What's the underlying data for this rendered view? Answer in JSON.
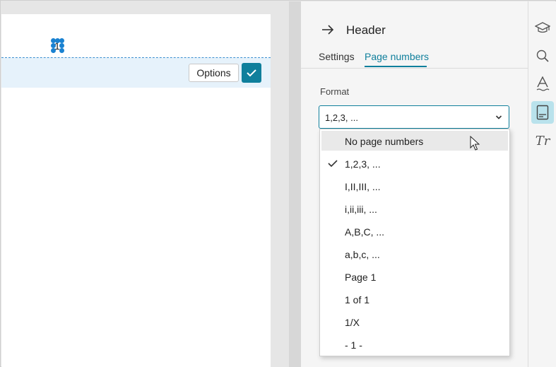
{
  "document": {
    "page_number_text": "1",
    "options_label": "Options"
  },
  "panel": {
    "title": "Header",
    "tabs": [
      {
        "label": "Settings",
        "active": false
      },
      {
        "label": "Page numbers",
        "active": true
      }
    ],
    "format_label": "Format",
    "format_selected": "1,2,3, ..."
  },
  "dropdown": {
    "options": [
      {
        "label": "No page numbers",
        "hovered": true,
        "checked": false
      },
      {
        "label": "1,2,3, ...",
        "hovered": false,
        "checked": true
      },
      {
        "label": "I,II,III, ...",
        "hovered": false,
        "checked": false
      },
      {
        "label": "i,ii,iii, ...",
        "hovered": false,
        "checked": false
      },
      {
        "label": "A,B,C, ...",
        "hovered": false,
        "checked": false
      },
      {
        "label": "a,b,c, ...",
        "hovered": false,
        "checked": false
      },
      {
        "label": "Page 1",
        "hovered": false,
        "checked": false
      },
      {
        "label": "1 of 1",
        "hovered": false,
        "checked": false
      },
      {
        "label": "1/X",
        "hovered": false,
        "checked": false
      },
      {
        "label": "- 1 -",
        "hovered": false,
        "checked": false
      }
    ]
  },
  "rail": {
    "items": [
      {
        "icon": "graduation-cap-icon",
        "active": false
      },
      {
        "icon": "search-icon",
        "active": false
      },
      {
        "icon": "spelling-icon",
        "active": false
      },
      {
        "icon": "header-footer-icon",
        "active": true
      },
      {
        "icon": "text-style-icon",
        "active": false,
        "text": "Tr"
      }
    ]
  },
  "colors": {
    "accent": "#0f7f9c",
    "header_band": "#e6f2fb",
    "handle": "#1a82d1",
    "rail_active": "#b9e2ec"
  }
}
